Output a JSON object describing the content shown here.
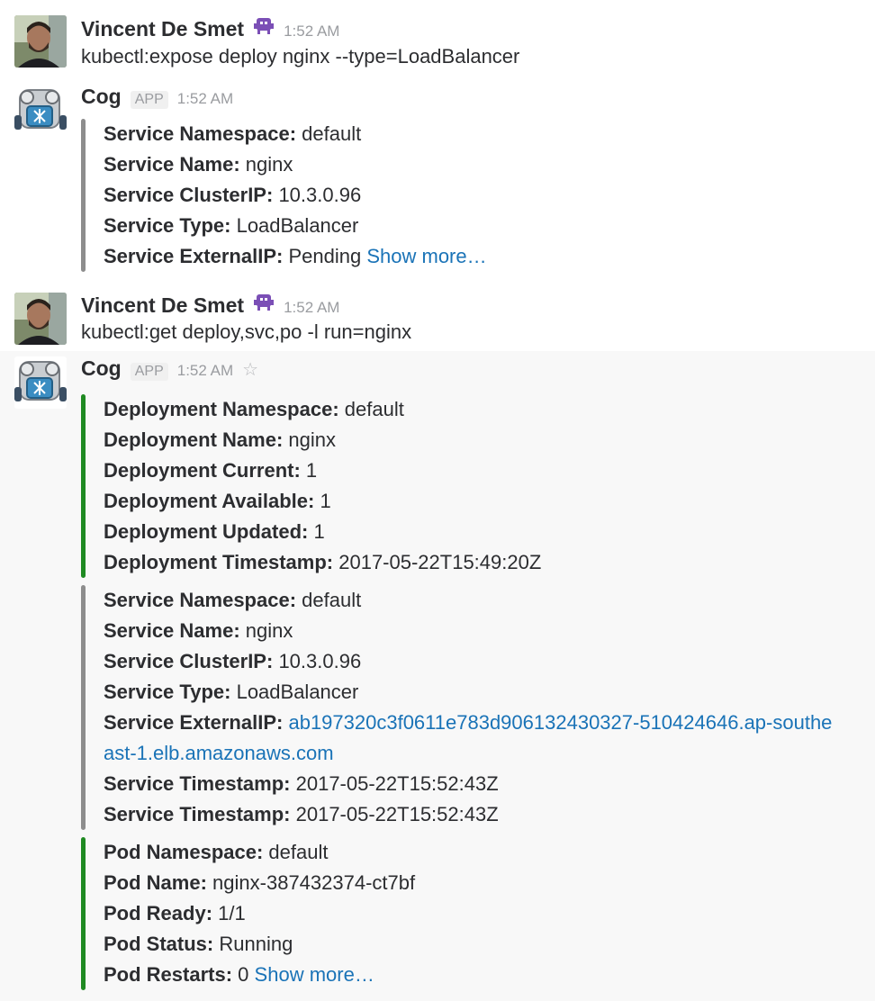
{
  "messages": [
    {
      "author": "Vincent De Smet",
      "time": "1:52 AM",
      "text": "kubectl:expose deploy nginx --type=LoadBalancer"
    },
    {
      "author": "Cog",
      "badge": "APP",
      "time": "1:52 AM",
      "attachment": {
        "fields": [
          {
            "label": "Service Namespace:",
            "value": "default"
          },
          {
            "label": "Service Name:",
            "value": "nginx"
          },
          {
            "label": "Service ClusterIP:",
            "value": "10.3.0.96"
          },
          {
            "label": "Service Type:",
            "value": "LoadBalancer"
          },
          {
            "label": "Service ExternalIP:",
            "value": "Pending",
            "link": "Show more…"
          }
        ]
      }
    },
    {
      "author": "Vincent De Smet",
      "time": "1:52 AM",
      "text": "kubectl:get deploy,svc,po -l run=nginx"
    },
    {
      "author": "Cog",
      "badge": "APP",
      "time": "1:52 AM",
      "attachments": [
        {
          "color": "#1f8a22",
          "fields": [
            {
              "label": "Deployment Namespace:",
              "value": "default"
            },
            {
              "label": "Deployment Name:",
              "value": "nginx"
            },
            {
              "label": "Deployment Current:",
              "value": "1"
            },
            {
              "label": "Deployment Available:",
              "value": "1"
            },
            {
              "label": "Deployment Updated:",
              "value": "1"
            },
            {
              "label": "Deployment Timestamp:",
              "value": "2017-05-22T15:49:20Z"
            }
          ]
        },
        {
          "color": "#8d8d8d",
          "fields": [
            {
              "label": "Service Namespace:",
              "value": "default"
            },
            {
              "label": "Service Name:",
              "value": "nginx"
            },
            {
              "label": "Service ClusterIP:",
              "value": "10.3.0.96"
            },
            {
              "label": "Service Type:",
              "value": "LoadBalancer"
            },
            {
              "label": "Service ExternalIP:",
              "value": "ab197320c3f0611e783d906132430327-510424646.ap-southeast-1.elb.amazonaws.com"
            },
            {
              "label": "Service Timestamp:",
              "value": "2017-05-22T15:52:43Z"
            },
            {
              "label": "Service Timestamp:",
              "value": "2017-05-22T15:52:43Z"
            }
          ]
        },
        {
          "color": "#1f8a22",
          "fields": [
            {
              "label": "Pod Namespace:",
              "value": "default"
            },
            {
              "label": "Pod Name:",
              "value": "nginx-387432374-ct7bf"
            },
            {
              "label": "Pod Ready:",
              "value": "1/1"
            },
            {
              "label": "Pod Status:",
              "value": "Running"
            },
            {
              "label": "Pod Restarts:",
              "value": "0",
              "link": "Show more…"
            }
          ]
        }
      ]
    }
  ],
  "icons": {
    "author_emoji": "space-invader-icon",
    "star": "star-outline-icon"
  }
}
